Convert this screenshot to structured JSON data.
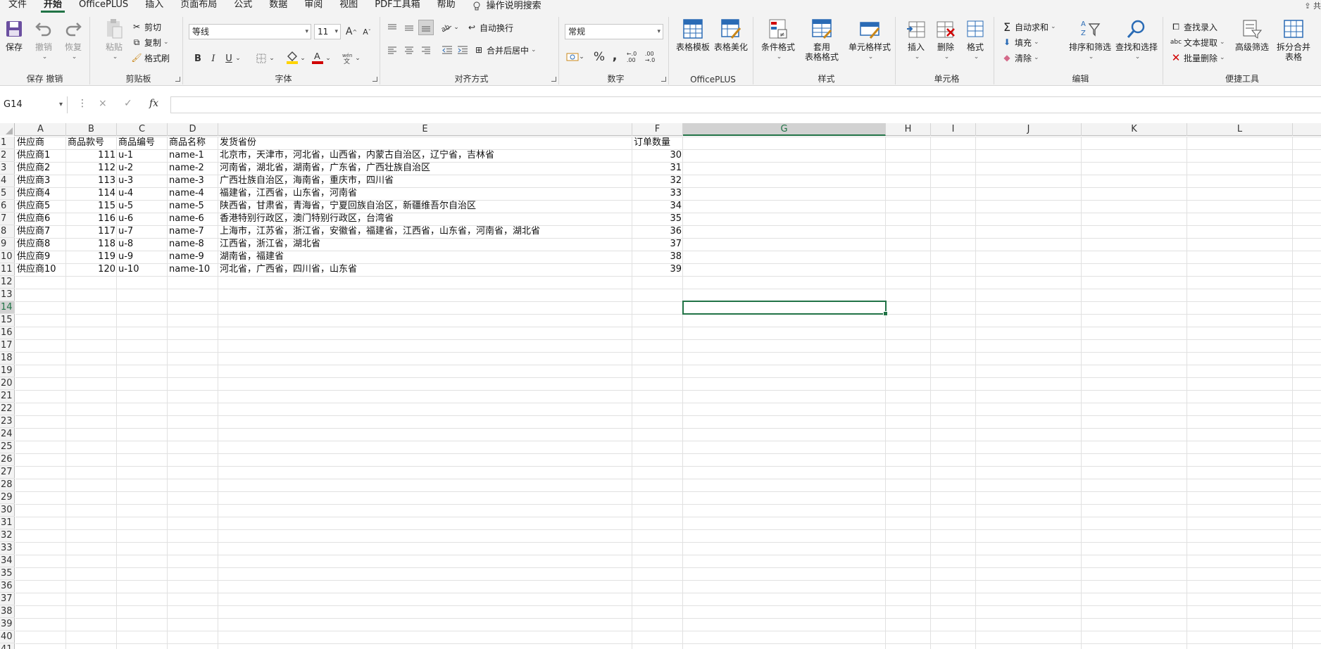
{
  "menu": {
    "tabs": [
      "文件",
      "开始",
      "OfficePLUS",
      "插入",
      "页面布局",
      "公式",
      "数据",
      "审阅",
      "视图",
      "PDF工具箱",
      "帮助"
    ],
    "search": "操作说明搜索",
    "share": "共"
  },
  "ribbon": {
    "save": {
      "save": "保存",
      "undo": "撤销",
      "redo": "恢复",
      "label": "保存 撤销"
    },
    "clipboard": {
      "paste": "粘贴",
      "cut": "剪切",
      "copy": "复制",
      "format_painter": "格式刷",
      "label": "剪贴板"
    },
    "font": {
      "name": "等线",
      "size": "11",
      "bold": "B",
      "italic": "I",
      "underline": "U",
      "grow": "A",
      "shrink": "A",
      "label": "字体"
    },
    "align": {
      "wrap": "自动换行",
      "merge": "合并后居中",
      "label": "对齐方式"
    },
    "number": {
      "format": "常规",
      "percent": "%",
      "comma": ",",
      "label": "数字"
    },
    "officeplus": {
      "template": "表格模板",
      "beautify": "表格美化",
      "label": "OfficePLUS"
    },
    "styles": {
      "conditional": "条件格式",
      "table": "套用\n表格格式",
      "cell": "单元格样式",
      "label": "样式"
    },
    "cells": {
      "insert": "插入",
      "delete": "删除",
      "format": "格式",
      "label": "单元格"
    },
    "editing": {
      "autosum": "自动求和",
      "fill": "填充",
      "clear": "清除",
      "sort": "排序和筛选",
      "find": "查找和选择",
      "label": "编辑"
    },
    "tools": {
      "lookup": "查找录入",
      "extract": "文本提取",
      "batch_delete": "批量删除",
      "advanced_filter": "高级筛选",
      "split_merge": "拆分合并\n表格",
      "label": "便捷工具"
    }
  },
  "formula_bar": {
    "name_box": "G14",
    "cancel": "×",
    "enter": "✓",
    "fx": "fx",
    "value": ""
  },
  "columns": [
    "A",
    "B",
    "C",
    "D",
    "E",
    "F",
    "G",
    "H",
    "I",
    "J",
    "K",
    "L"
  ],
  "rows": [
    "1",
    "2",
    "3",
    "4",
    "5",
    "6",
    "7",
    "8",
    "9",
    "10",
    "11",
    "12",
    "13",
    "14",
    "15",
    "16",
    "17",
    "18",
    "19",
    "20",
    "21",
    "22",
    "23",
    "24",
    "25",
    "26",
    "27",
    "28",
    "29",
    "30",
    "31",
    "32",
    "33",
    "34",
    "35",
    "36",
    "37",
    "38",
    "39",
    "40",
    "41"
  ],
  "selected_cell": "G14",
  "header": [
    "供应商",
    "商品款号",
    "商品编号",
    "商品名称",
    "发货省份",
    "订单数量"
  ],
  "data": [
    [
      "供应商1",
      "111",
      "u-1",
      "name-1",
      "北京市，天津市，河北省，山西省，内蒙古自治区，辽宁省，吉林省",
      "30"
    ],
    [
      "供应商2",
      "112",
      "u-2",
      "name-2",
      "河南省，湖北省，湖南省，广东省，广西壮族自治区",
      "31"
    ],
    [
      "供应商3",
      "113",
      "u-3",
      "name-3",
      "广西壮族自治区，海南省，重庆市，四川省",
      "32"
    ],
    [
      "供应商4",
      "114",
      "u-4",
      "name-4",
      "福建省，江西省，山东省，河南省",
      "33"
    ],
    [
      "供应商5",
      "115",
      "u-5",
      "name-5",
      "陕西省，甘肃省，青海省，宁夏回族自治区，新疆维吾尔自治区",
      "34"
    ],
    [
      "供应商6",
      "116",
      "u-6",
      "name-6",
      "香港特别行政区，澳门特别行政区，台湾省",
      "35"
    ],
    [
      "供应商7",
      "117",
      "u-7",
      "name-7",
      "上海市，江苏省，浙江省，安徽省，福建省，江西省，山东省，河南省，湖北省",
      "36"
    ],
    [
      "供应商8",
      "118",
      "u-8",
      "name-8",
      "江西省，浙江省，湖北省",
      "37"
    ],
    [
      "供应商9",
      "119",
      "u-9",
      "name-9",
      "湖南省，福建省",
      "38"
    ],
    [
      "供应商10",
      "120",
      "u-10",
      "name-10",
      "河北省，广西省，四川省，山东省",
      "39"
    ]
  ],
  "colors": {
    "accent": "#217346",
    "font_color_bar": "#d00000",
    "highlight_bar": "#ffd400"
  }
}
